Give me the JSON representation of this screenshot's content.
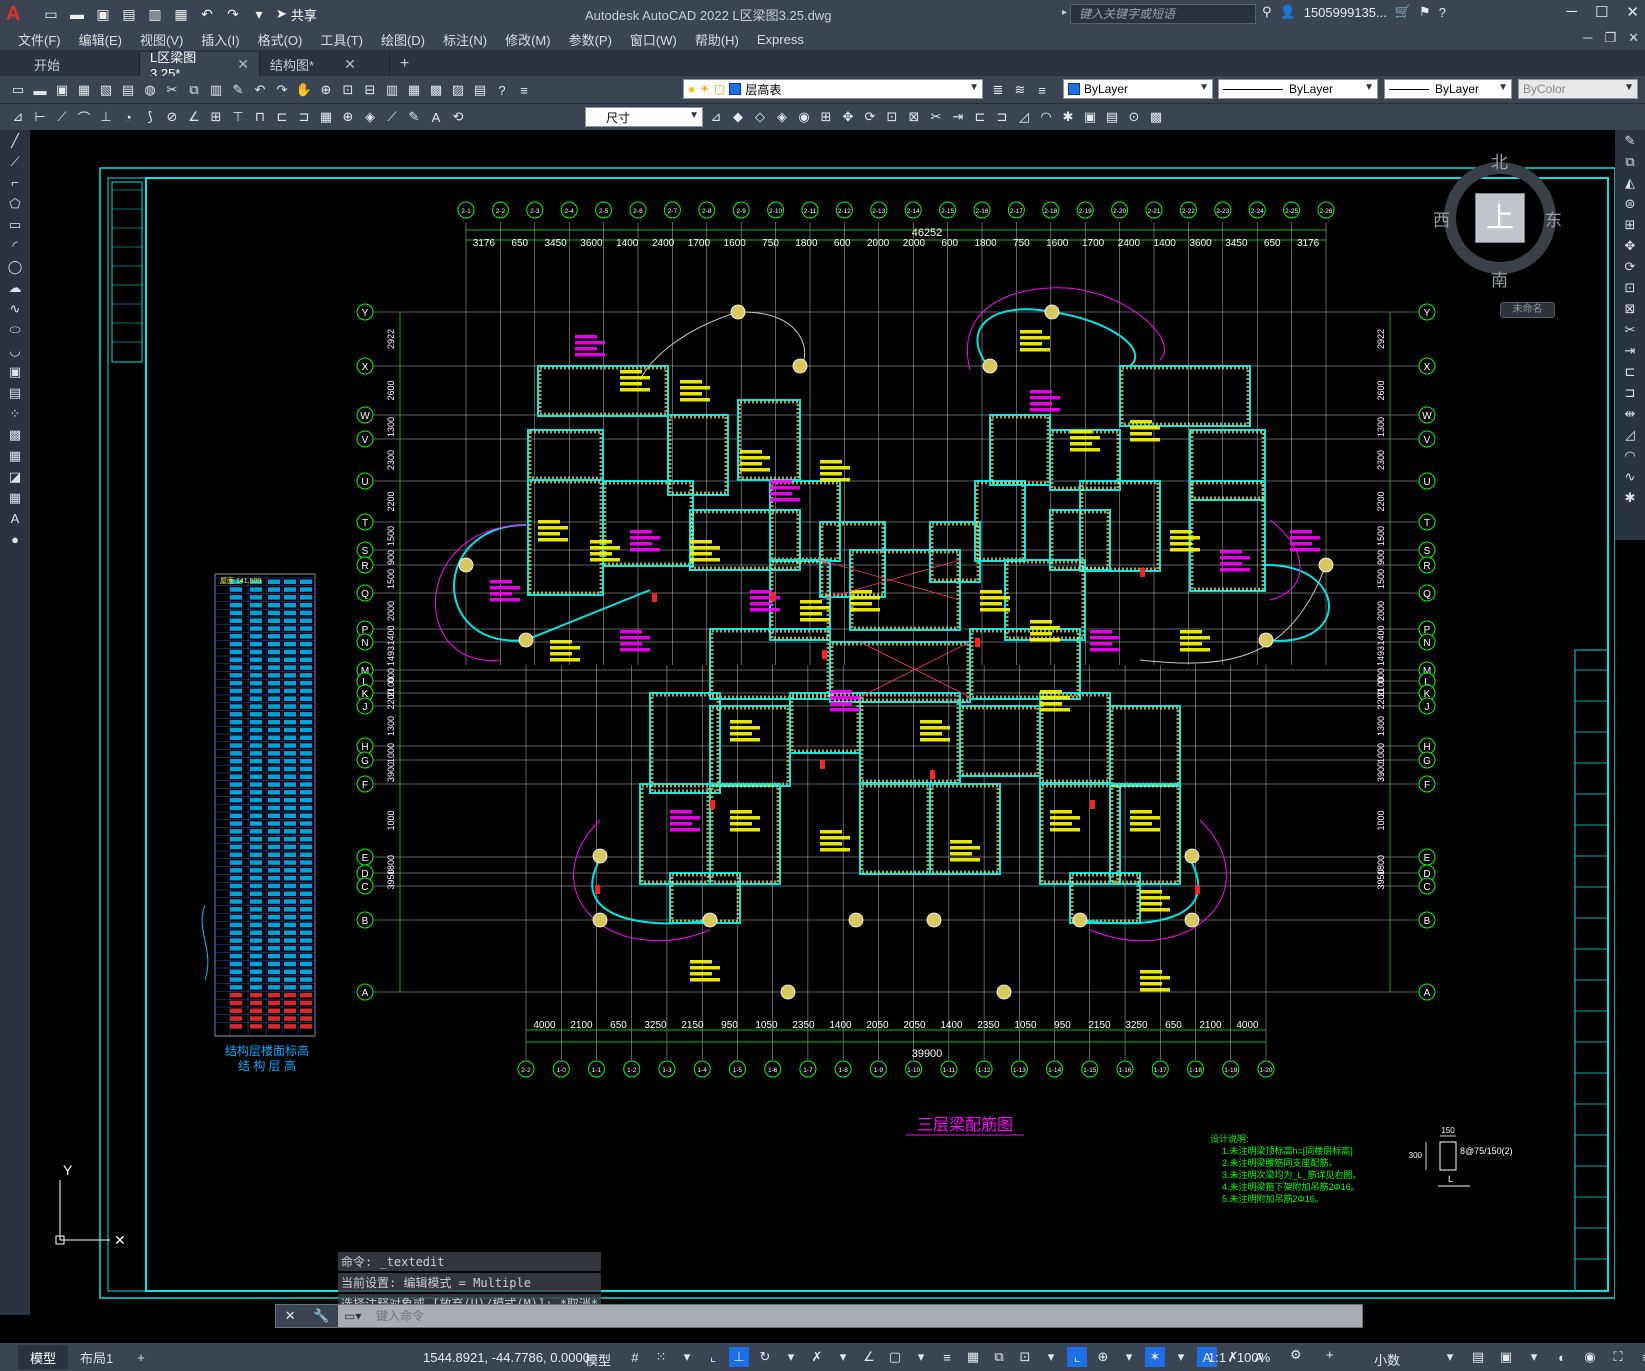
{
  "titlebar": {
    "share_label": "共享",
    "window_title": "Autodesk AutoCAD 2022    L区梁图3.25.dwg",
    "search_placeholder": "键入关键字或短语",
    "user": "1505999135...",
    "icons": [
      "new-icon",
      "open-icon",
      "save-icon",
      "saveas-icon",
      "publish-icon",
      "plot-icon",
      "undo-icon",
      "redo-icon",
      "share-icon"
    ]
  },
  "menubar": {
    "items": [
      "文件(F)",
      "编辑(E)",
      "视图(V)",
      "插入(I)",
      "格式(O)",
      "工具(T)",
      "绘图(D)",
      "标注(N)",
      "修改(M)",
      "参数(P)",
      "窗口(W)",
      "帮助(H)",
      "Express"
    ]
  },
  "tabs": {
    "start": "开始",
    "doc1": "L区梁图3.25*",
    "doc2": "结构图*"
  },
  "toolbar": {
    "layer_name": "层高表",
    "color": "ByLayer",
    "linetype": "ByLayer",
    "lineweight": "ByLayer",
    "plotstyle": "ByColor",
    "dimstyle": "尺寸"
  },
  "viewcube": {
    "top": "上",
    "north": "北",
    "south": "南",
    "east": "东",
    "west": "西",
    "unnamed": "未命名"
  },
  "drawing": {
    "title": "三层梁配筋图",
    "total_width_top": "46252",
    "total_width_bottom": "39900",
    "top_dims": [
      "3176",
      "650",
      "3450",
      "3600",
      "1400",
      "2400",
      "1700",
      "1600",
      "750",
      "1800",
      "600",
      "2000",
      "2000",
      "600",
      "1800",
      "750",
      "1600",
      "1700",
      "2400",
      "1400",
      "3600",
      "3450",
      "650",
      "3176"
    ],
    "bottom_dims": [
      "4000",
      "2100",
      "650",
      "3250",
      "2150",
      "950",
      "1050",
      "2350",
      "1400",
      "2050",
      "2050",
      "1400",
      "2350",
      "1050",
      "950",
      "2150",
      "3250",
      "650",
      "2100",
      "4000"
    ],
    "top_axes": [
      "2-1",
      "2-2",
      "2-3",
      "2-4",
      "2-5",
      "2-6",
      "2-7",
      "2-8",
      "2-9",
      "2-10",
      "2-11",
      "2-12",
      "2-13",
      "2-14",
      "2-15",
      "2-16",
      "2-17",
      "2-18",
      "2-19",
      "2-20",
      "2-21",
      "2-22",
      "2-23",
      "2-24",
      "2-25",
      "2-26"
    ],
    "bottom_axes": [
      "2-2",
      "1-0",
      "1-1",
      "1-2",
      "1-3",
      "1-4",
      "1-5",
      "1-6",
      "1-7",
      "1-8",
      "1-9",
      "1-10",
      "1-11",
      "1-12",
      "1-13",
      "1-14",
      "1-15",
      "1-16",
      "1-17",
      "1-18",
      "1-19",
      "1-20"
    ],
    "row_axes": [
      "Y",
      "X",
      "W",
      "V",
      "U",
      "T",
      "S",
      "R",
      "Q",
      "P",
      "N",
      "M",
      "L",
      "K",
      "J",
      "H",
      "G",
      "F",
      "E",
      "D",
      "C",
      "B",
      "A"
    ],
    "left_dims": [
      "2922",
      "2600",
      "1300",
      "2300",
      "2200",
      "1500",
      "900",
      "1500",
      "2000",
      "1400",
      "1493",
      "000",
      "2100",
      "2200",
      "1300",
      "1000",
      "3900",
      "1000",
      "1800",
      "3950"
    ],
    "notes_title": "设计说明:",
    "notes": [
      "1.未注明梁顶标高h=[同楼层标高]",
      "2.未注明梁腰筋同支座配筋。",
      "3.未注明次梁均为_L_筋详见右图。",
      "4.未注明梁箍下架附加吊筋2Φ16。",
      "5.未注明附加吊筋2Φ16。"
    ],
    "section_label": "8@75/150(2)",
    "section_dim1": "150",
    "section_dim2": "300",
    "section_lbl": "L",
    "level_table_caption1": "结构层楼面标高",
    "level_table_caption2": "结 构 层 高",
    "level_table_header": "屋面 141.500"
  },
  "command": {
    "history": [
      "命令: _textedit",
      "当前设置: 编辑模式 = Multiple",
      "选择注释对象或 [放弃(U)/模式(M)]: *取消*"
    ],
    "placeholder": "键入命令"
  },
  "statusbar": {
    "model_tab": "模型",
    "layout_tab": "布局1",
    "coordinates": "1544.8921, -44.7786, 0.0000",
    "model_label": "模型",
    "scale": "1:1 / 100%",
    "units": "小数"
  },
  "ucs": {
    "y_label": "Y"
  }
}
